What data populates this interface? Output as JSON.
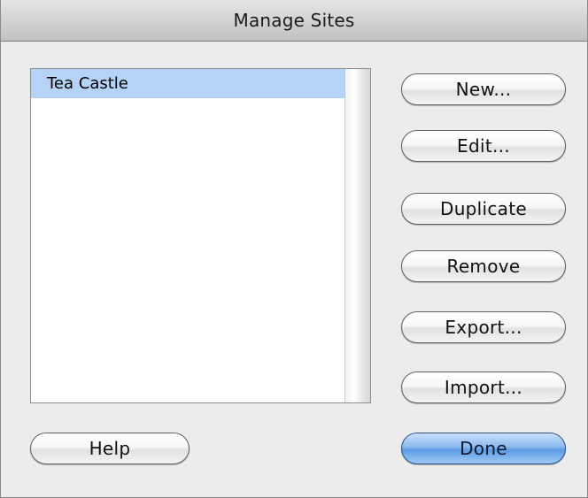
{
  "window": {
    "title": "Manage Sites"
  },
  "sites": {
    "items": [
      {
        "label": "Tea Castle",
        "selected": true
      }
    ]
  },
  "buttons": {
    "new_label": "New...",
    "edit_label": "Edit...",
    "duplicate_label": "Duplicate",
    "remove_label": "Remove",
    "export_label": "Export...",
    "import_label": "Import...",
    "help_label": "Help",
    "done_label": "Done"
  },
  "colors": {
    "window_bg": "#ececec",
    "selection": "#b5d3f7",
    "default_button": "#5d9be4"
  }
}
